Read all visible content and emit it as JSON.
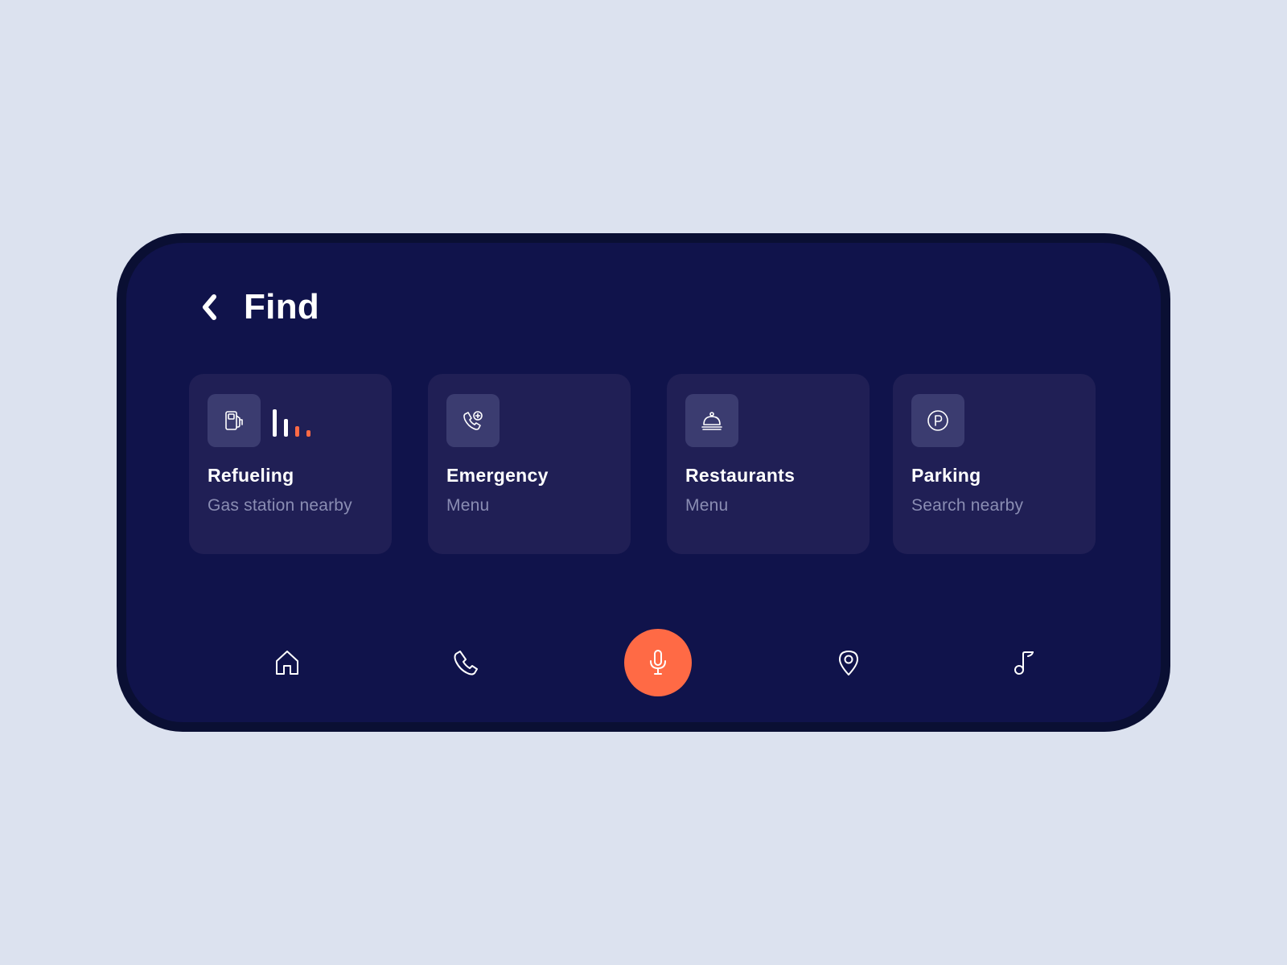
{
  "header": {
    "title": "Find",
    "back_icon": "chevron-left-icon"
  },
  "cards": [
    {
      "title": "Refueling",
      "subtitle": "Gas station nearby",
      "icon": "fuel-pump-icon",
      "fuel_level_bars": 4,
      "fuel_level_bars_filled": 2
    },
    {
      "title": "Emergency",
      "subtitle": "Menu",
      "icon": "phone-medical-icon"
    },
    {
      "title": "Restaurants",
      "subtitle": "Menu",
      "icon": "cloche-icon"
    },
    {
      "title": "Parking",
      "subtitle": "Search nearby",
      "icon": "parking-icon"
    }
  ],
  "bottom_nav": {
    "items": [
      {
        "icon": "home-icon"
      },
      {
        "icon": "phone-icon"
      },
      {
        "icon": "microphone-icon",
        "active": true
      },
      {
        "icon": "location-pin-icon"
      },
      {
        "icon": "music-note-icon"
      }
    ]
  },
  "colors": {
    "page_background": "#DCE2EF",
    "device_background": "#10134B",
    "device_bezel": "#0A0F33",
    "card_background": "#201F55",
    "icon_box_background": "#3B3C70",
    "accent": "#FF6A45",
    "text_primary": "#FFFFFF",
    "text_secondary": "#8A8DB3"
  }
}
